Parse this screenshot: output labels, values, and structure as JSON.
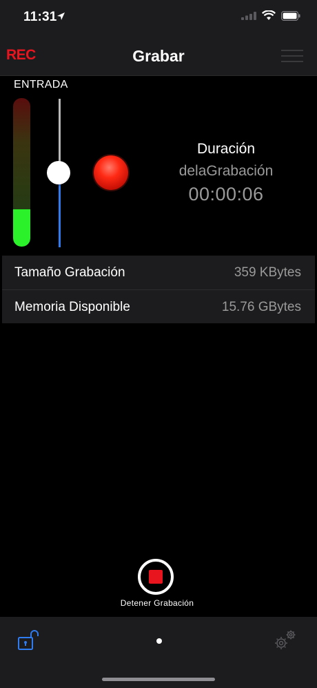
{
  "status": {
    "time": "11:31"
  },
  "nav": {
    "rec_label": "REC",
    "title": "Grabar"
  },
  "input": {
    "label": "ENTRADA",
    "meter_level": 0.25,
    "gain_level": 0.5
  },
  "duration": {
    "title": "Duración",
    "subtitle": "delaGrabación",
    "time": "00:00:06"
  },
  "info": [
    {
      "label": "Tamaño Grabación",
      "value": "359 KBytes"
    },
    {
      "label": "Memoria Disponible",
      "value": "15.76 GBytes"
    }
  ],
  "stop": {
    "label": "Detener Grabación"
  },
  "colors": {
    "rec_red": "#e8141e",
    "meter_green": "#2af12a",
    "slider_blue": "#2f7bf0",
    "tab_blue": "#2f7bf0"
  },
  "icons": [
    "location-arrow-icon",
    "signal-icon",
    "wifi-icon",
    "battery-icon",
    "menu-icon",
    "unlock-icon",
    "gear-icon"
  ]
}
